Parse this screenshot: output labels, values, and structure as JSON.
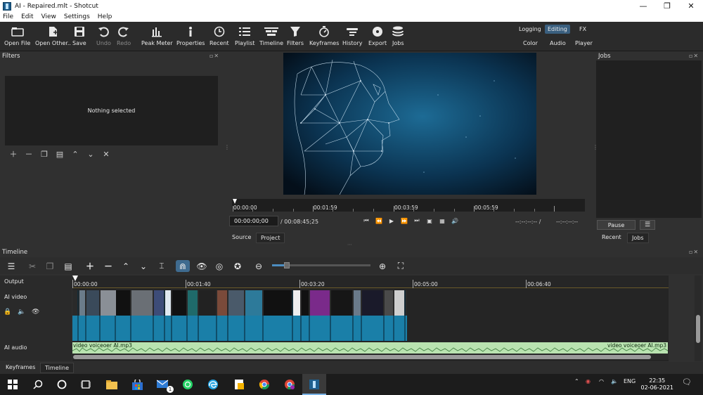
{
  "window": {
    "title": "AI - Repaired.mlt - Shotcut",
    "minimize": "—",
    "restore": "❐",
    "close": "✕"
  },
  "menu": [
    "File",
    "Edit",
    "View",
    "Settings",
    "Help"
  ],
  "toolbar": {
    "open_file": "Open File",
    "open_other": "Open Other..",
    "save": "Save",
    "undo": "Undo",
    "redo": "Redo",
    "peak_meter": "Peak Meter",
    "properties": "Properties",
    "recent": "Recent",
    "playlist": "Playlist",
    "timeline": "Timeline",
    "filters": "Filters",
    "keyframes": "Keyframes",
    "history": "History",
    "export": "Export",
    "jobs": "Jobs"
  },
  "layouts": {
    "logging": "Logging",
    "editing": "Editing",
    "fx": "FX",
    "color": "Color",
    "audio": "Audio",
    "player": "Player"
  },
  "filters_panel": {
    "title": "Filters",
    "empty_message": "Nothing selected"
  },
  "player": {
    "ruler_labels": [
      "00:00:00",
      "00:01:59",
      "00:03:59",
      "00:05:59"
    ],
    "position": "00:00:00;00",
    "duration": "/ 00:08:45;25",
    "in_point": "--:--:--:-- /",
    "out_point": "--:--:--:--",
    "source_tab": "Source",
    "project_tab": "Project"
  },
  "jobs_panel": {
    "title": "Jobs",
    "pause_button": "Pause",
    "menu_button": "☰",
    "recent_tab": "Recent",
    "jobs_tab": "Jobs"
  },
  "timeline": {
    "title": "Timeline",
    "ruler_labels": [
      "00:00:00",
      "00:01:40",
      "00:03:20",
      "00:05:00",
      "00:06:40"
    ],
    "tracks": {
      "output": "Output",
      "video": "AI video",
      "audio": "AI audio"
    },
    "audio_clip_label": "video voiceoer AI.mp3",
    "audio_clip_label_end": "video voiceoer AI.mp3"
  },
  "bottom_tabs": {
    "keyframes": "Keyframes",
    "timeline": "Timeline"
  },
  "taskbar": {
    "language": "ENG",
    "time": "22:35",
    "date": "02-06-2021",
    "mail_badge": "1"
  },
  "colors": {
    "accent": "#3a5f7f",
    "video_clip": "#1a7fa8",
    "audio_clip": "#b9e3b0"
  }
}
